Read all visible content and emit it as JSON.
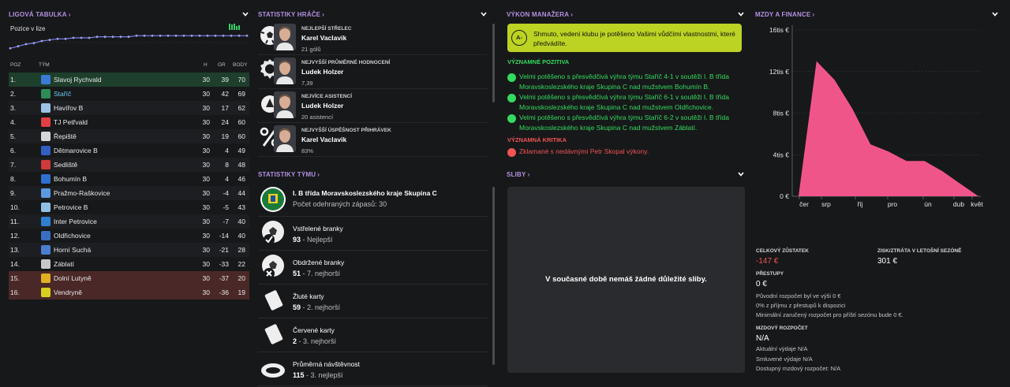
{
  "league": {
    "title": "LIGOVÁ TABULKA",
    "position_label": "Pozice v lize",
    "form_levels": [
      1.0,
      0.85,
      1.0,
      0.6,
      0.8
    ],
    "position_history": [
      14,
      12,
      10,
      9,
      7,
      6,
      5,
      5,
      4,
      4,
      4,
      3,
      3,
      3,
      3,
      3,
      2,
      2,
      2,
      2,
      2,
      2,
      2,
      2,
      2,
      2,
      2,
      2,
      2,
      2,
      2
    ],
    "columns": {
      "pos": "POZ",
      "team": "TÝM",
      "h": "H",
      "gr": "GR",
      "body": "BODY"
    },
    "rows": [
      {
        "pos": "1.",
        "team": "Slavoj Rychvald",
        "h": "30",
        "gr": "39",
        "body": "70",
        "zone": "promo",
        "crest": "#3a7bd5"
      },
      {
        "pos": "2.",
        "team": "Staříč",
        "h": "30",
        "gr": "42",
        "body": "69",
        "zone": "",
        "crest": "#2e8b57",
        "highlight": true
      },
      {
        "pos": "3.",
        "team": "Havířov B",
        "h": "30",
        "gr": "17",
        "body": "62",
        "zone": "",
        "crest": "#9cc3e6"
      },
      {
        "pos": "4.",
        "team": "TJ Petřvald",
        "h": "30",
        "gr": "24",
        "body": "60",
        "zone": "",
        "crest": "#e04040"
      },
      {
        "pos": "5.",
        "team": "Řepiště",
        "h": "30",
        "gr": "19",
        "body": "60",
        "zone": "",
        "crest": "#d8d8d8"
      },
      {
        "pos": "6.",
        "team": "Dětmarovice B",
        "h": "30",
        "gr": "4",
        "body": "49",
        "zone": "",
        "crest": "#3060c0"
      },
      {
        "pos": "7.",
        "team": "Sedliště",
        "h": "30",
        "gr": "8",
        "body": "48",
        "zone": "",
        "crest": "#d03a3a"
      },
      {
        "pos": "8.",
        "team": "Bohumín B",
        "h": "30",
        "gr": "4",
        "body": "46",
        "zone": "",
        "crest": "#2f6fd0"
      },
      {
        "pos": "9.",
        "team": "Pražmo-Raškovice",
        "h": "30",
        "gr": "-4",
        "body": "44",
        "zone": "",
        "crest": "#5a9be0"
      },
      {
        "pos": "10.",
        "team": "Petrovice B",
        "h": "30",
        "gr": "-5",
        "body": "43",
        "zone": "",
        "crest": "#8fc0e8"
      },
      {
        "pos": "11.",
        "team": "Inter Petrovice",
        "h": "30",
        "gr": "-7",
        "body": "40",
        "zone": "",
        "crest": "#2f7fd0"
      },
      {
        "pos": "12.",
        "team": "Oldřichovice",
        "h": "30",
        "gr": "-14",
        "body": "40",
        "zone": "",
        "crest": "#3a6fc0"
      },
      {
        "pos": "13.",
        "team": "Horní Suchá",
        "h": "30",
        "gr": "-21",
        "body": "28",
        "zone": "",
        "crest": "#4a7fd0"
      },
      {
        "pos": "14.",
        "team": "Záblatí",
        "h": "30",
        "gr": "-33",
        "body": "22",
        "zone": "",
        "crest": "#c8c8c8"
      },
      {
        "pos": "15.",
        "team": "Dolní Lutyně",
        "h": "30",
        "gr": "-37",
        "body": "20",
        "zone": "releg",
        "crest": "#e0b020"
      },
      {
        "pos": "16.",
        "team": "Vendryně",
        "h": "30",
        "gr": "-36",
        "body": "19",
        "zone": "releg",
        "crest": "#d8d020"
      }
    ]
  },
  "player_stats": {
    "title": "STATISTIKY HRÁČE",
    "items": [
      {
        "label": "NEJLEPŠÍ STŘELEC",
        "name": "Karel Vaclavik",
        "value": "21 gólů",
        "icon": "football-icon"
      },
      {
        "label": "NEJVYŠŠÍ PRŮMĚRNÉ HODNOCENÍ",
        "name": "Ludek Holzer",
        "value": "7,39",
        "icon": "rating-badge-icon"
      },
      {
        "label": "NEJVÍCE ASISTENCÍ",
        "name": "Ludek Holzer",
        "value": "20 asistencí",
        "icon": "assist-icon"
      },
      {
        "label": "NEJVYŠŠÍ ÚSPĚŠNOST PŘIHRÁVEK",
        "name": "Karel Vaclavik",
        "value": "83%",
        "icon": "percent-icon"
      }
    ]
  },
  "team_stats": {
    "title": "STATISTIKY TÝMU",
    "items": [
      {
        "title": "I. B třída Moravskoslezského kraje Skupina C",
        "value": "Počet odehraných zápasů: 30",
        "rest": "",
        "icon": "league-crest-icon",
        "bold_title": true
      },
      {
        "title": "Vstřelené branky",
        "value": "93",
        "rest": " - Nejlepší",
        "icon": "goals-scored-icon"
      },
      {
        "title": "Obdržené branky",
        "value": "51",
        "rest": " - 7. nejhorší",
        "icon": "goals-conceded-icon"
      },
      {
        "title": "Žluté karty",
        "value": "59",
        "rest": " - 2. nejhorší",
        "icon": "yellow-card-icon"
      },
      {
        "title": "Červené karty",
        "value": "2",
        "rest": " - 3. nejhorší",
        "icon": "red-card-icon"
      },
      {
        "title": "Průměrná návštěvnost",
        "value": "115",
        "rest": " - 3. nejlepší",
        "icon": "attendance-icon"
      }
    ]
  },
  "manager": {
    "title": "VÝKON MANAŽERA",
    "grade": "A-",
    "summary": "Shmuto, vedení klubu je potěšeno Vašimi vůdčími vlastnostmi, které předvádíte.",
    "positives_title": "VÝZNAMNÉ POZITIVA",
    "positives": [
      "Velmi potěšeno s přesvědčivá výhra týmu Staříč 4-1 v soutěži I. B třída Moravskoslezského kraje Skupina C nad mužstvem Bohumín B.",
      "Velmi potěšeno s přesvědčivá výhra týmu Staříč 6-1 v soutěži I. B třída Moravskoslezského kraje Skupina C nad mužstvem Oldřichovice.",
      "Velmi potěšeno s přesvědčivá výhra týmu Staříč 6-2 v soutěži I. B třída Moravskoslezského kraje Skupina C nad mužstvem Záblatí."
    ],
    "criticism_title": "VÝZNAMNÁ KRITIKA",
    "criticism": [
      "Zklamané s nedávnými Petr Skopal výkony."
    ],
    "colors": {
      "box": "#bdd323",
      "positive": "#34db5e",
      "negative": "#f05454"
    }
  },
  "promises": {
    "title": "SLIBY",
    "empty": "V současné době nemáš žádné důležité sliby."
  },
  "finance": {
    "title": "MZDY A FINANCE",
    "balance_label": "CELKOVÝ ZŮSTATEK",
    "balance": "-147 €",
    "profit_label": "ZISK/ZTRÁTA V LETOŠNÍ SEZÓNĚ",
    "profit": "301 €",
    "transfers_label": "PŘESTUPY",
    "transfers": "0 €",
    "transfer_lines": [
      "Původní rozpočet byl ve výši 0 €",
      "0% z příjmu z přestupů k dispozici",
      "Minimální zaručený rozpočet pro příští sezónu bude 0 €."
    ],
    "wage_label": "MZDOVÝ ROZPOČET",
    "wage": "N/A",
    "wage_lines": [
      "Aktuální výdaje N/A",
      "Smluvené výdaje N/A",
      "Dostupný mzdový rozpočet: N/A"
    ]
  },
  "chart_data": {
    "type": "area",
    "x": [
      "čer",
      "",
      "srp",
      "",
      "říj",
      "",
      "pro",
      "",
      "ún",
      "",
      "dub",
      "květ"
    ],
    "tick_labels": [
      "čer",
      "srp",
      "říj",
      "pro",
      "ún",
      "dub",
      "květ"
    ],
    "series": [
      {
        "values": [
          0,
          13000,
          11200,
          8400,
          5000,
          4300,
          3400,
          3400,
          2400,
          1200,
          0
        ]
      }
    ],
    "y_ticks": [
      "16tis €",
      "12tis €",
      "8tis €",
      "4tis €",
      "0 €"
    ],
    "ylim": [
      0,
      16000
    ],
    "color": "#f0558a",
    "grid": true
  }
}
